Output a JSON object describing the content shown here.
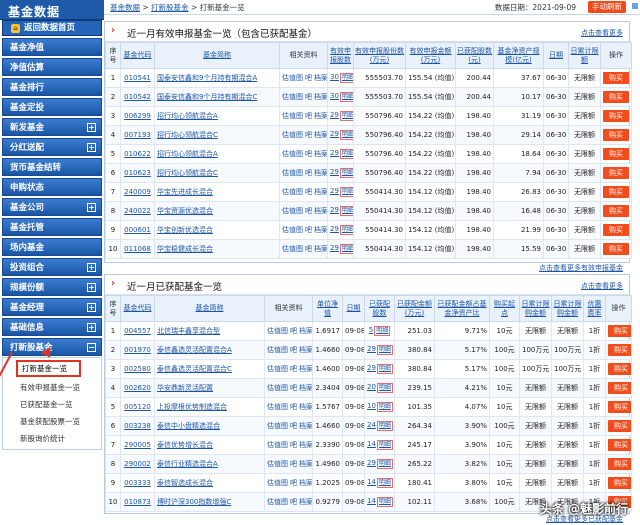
{
  "logo": "基金数据",
  "sidebar": {
    "back_home": "返回数据首页",
    "items": [
      {
        "label": "基金净值",
        "pm": ""
      },
      {
        "label": "净值估算",
        "pm": ""
      },
      {
        "label": "基金排行",
        "pm": ""
      },
      {
        "label": "基金定投",
        "pm": ""
      },
      {
        "label": "新发基金",
        "pm": "+"
      },
      {
        "label": "分红送配",
        "pm": "+"
      },
      {
        "label": "货币基金结转",
        "pm": ""
      },
      {
        "label": "申购状态",
        "pm": ""
      },
      {
        "label": "基金公司",
        "pm": "+"
      },
      {
        "label": "基金托管",
        "pm": ""
      },
      {
        "label": "场内基金",
        "pm": ""
      },
      {
        "label": "投资组合",
        "pm": "+"
      },
      {
        "label": "规模份额",
        "pm": "+"
      },
      {
        "label": "基金经理",
        "pm": "+"
      },
      {
        "label": "基础信息",
        "pm": "+"
      },
      {
        "label": "打新股基金",
        "pm": "−"
      }
    ],
    "sub": [
      {
        "label": "打新基金一览",
        "active": true
      },
      {
        "label": "有效申报基金一览",
        "active": false
      },
      {
        "label": "已获配基金一览",
        "active": false
      },
      {
        "label": "基金获配股票一览",
        "active": false
      },
      {
        "label": "新股询价统计",
        "active": false
      }
    ]
  },
  "topbar": {
    "breadcrumb": [
      "基金数据",
      "打新股基金",
      "打新基金一览"
    ],
    "date_label": "数据日期：2021-09-09",
    "refresh": "手动刷新"
  },
  "panel1": {
    "title": "近一月有效申报基金一览（包含已获配基金）",
    "more": "点击查看更多",
    "footer": "点击查看更多有效申报基金",
    "headers": [
      "序号",
      "基金代码",
      "基金简称",
      "相关资料",
      "有效申报股数",
      "有效申报股份数(万元)",
      "有效申报金额(万元)",
      "已获配股数(元)",
      "基金净资产规模(亿元)",
      "日期",
      "日累计限额",
      "操作"
    ],
    "rows": [
      {
        "no": "1",
        "code": "010541",
        "name": "国泰安信鑫和9个月持有期混合A",
        "rel": [
          "估值图",
          "吧",
          "档案"
        ],
        "days": "30",
        "tag": "明细",
        "shares": "555503.70",
        "amt": "155.54 (均值)",
        "alloc": "200.44",
        "scale": "37.67",
        "date": "06-30",
        "limit": "无限额",
        "op": "购买"
      },
      {
        "no": "2",
        "code": "010542",
        "name": "国泰安信鑫和9个月持有期混合C",
        "rel": [
          "估值图",
          "吧",
          "档案"
        ],
        "days": "30",
        "tag": "明细",
        "shares": "555503.70",
        "amt": "155.54 (均值)",
        "alloc": "200.44",
        "scale": "10.17",
        "date": "06-30",
        "limit": "无限额",
        "op": "购买"
      },
      {
        "no": "3",
        "code": "006299",
        "name": "招行均心领航混合A",
        "rel": [
          "估值图",
          "吧",
          "档案"
        ],
        "days": "29",
        "tag": "明细",
        "shares": "550796.40",
        "amt": "154.22 (均值)",
        "alloc": "198.40",
        "scale": "31.19",
        "date": "06-30",
        "limit": "无限额",
        "op": "购买"
      },
      {
        "no": "4",
        "code": "007193",
        "name": "招行均心领航混合C",
        "rel": [
          "估值图",
          "吧",
          "档案"
        ],
        "days": "29",
        "tag": "明细",
        "shares": "550796.40",
        "amt": "154.22 (均值)",
        "alloc": "198.40",
        "scale": "29.14",
        "date": "06-30",
        "limit": "无限额",
        "op": "购买"
      },
      {
        "no": "5",
        "code": "010622",
        "name": "招行均心领航混合A",
        "rel": [
          "估值图",
          "吧",
          "档案"
        ],
        "days": "29",
        "tag": "明细",
        "shares": "550796.40",
        "amt": "154.22 (均值)",
        "alloc": "198.40",
        "scale": "18.64",
        "date": "06-30",
        "limit": "无限额",
        "op": "购买"
      },
      {
        "no": "6",
        "code": "010623",
        "name": "招行均心领航混合C",
        "rel": [
          "估值图",
          "吧",
          "档案"
        ],
        "days": "29",
        "tag": "明细",
        "shares": "550796.40",
        "amt": "154.22 (均值)",
        "alloc": "198.40",
        "scale": "7.94",
        "date": "06-30",
        "limit": "无限额",
        "op": "购买"
      },
      {
        "no": "7",
        "code": "240009",
        "name": "华宝先进成长混合",
        "rel": [
          "估值图",
          "吧",
          "档案"
        ],
        "days": "29",
        "tag": "明细",
        "shares": "550414.30",
        "amt": "154.12 (均值)",
        "alloc": "198.40",
        "scale": "26.83",
        "date": "06-30",
        "limit": "无限额",
        "op": "购买"
      },
      {
        "no": "8",
        "code": "240022",
        "name": "华宝资源优选混合",
        "rel": [
          "估值图",
          "吧",
          "档案"
        ],
        "days": "29",
        "tag": "明细",
        "shares": "550414.30",
        "amt": "154.12 (均值)",
        "alloc": "198.40",
        "scale": "16.48",
        "date": "06-30",
        "limit": "无限额",
        "op": "购买"
      },
      {
        "no": "9",
        "code": "000601",
        "name": "华宝创新优选混合",
        "rel": [
          "估值图",
          "吧",
          "档案"
        ],
        "days": "29",
        "tag": "明细",
        "shares": "550414.30",
        "amt": "154.12 (均值)",
        "alloc": "198.40",
        "scale": "21.99",
        "date": "06-30",
        "limit": "无限额",
        "op": "购买"
      },
      {
        "no": "10",
        "code": "011068",
        "name": "华宝稳健成长混合",
        "rel": [
          "估值图",
          "吧",
          "档案"
        ],
        "days": "29",
        "tag": "明细",
        "shares": "550414.30",
        "amt": "154.12 (均值)",
        "alloc": "198.40",
        "scale": "15.59",
        "date": "06-30",
        "limit": "无限额",
        "op": "购买"
      }
    ]
  },
  "panel2": {
    "title": "近一月已获配基金一览",
    "more": "点击查看更多",
    "footer": "点击查看更多已获配基金",
    "headers": [
      "序号",
      "基金代码",
      "基金简称",
      "相关资料",
      "单位净值",
      "日期",
      "已获配股数",
      "已获配金额(万元)",
      "已获配金额占基金净资产比",
      "购买起点",
      "日累计限购金额",
      "日累计限购金额",
      "优惠费率",
      "操作"
    ],
    "rows": [
      {
        "no": "1",
        "code": "004557",
        "name": "北信瑞丰鑫享混合型",
        "rel": [
          "估值图",
          "吧",
          "档案"
        ],
        "nav": "1.6917",
        "date": "09-08",
        "cnt": "5",
        "tag": "明细",
        "amt": "251.03",
        "ratio": "9.71%",
        "start": "10元",
        "limit": "无限额",
        "fee": "1折",
        "op": "购买"
      },
      {
        "no": "2",
        "code": "001970",
        "name": "泰信鑫选灵活配置混合A",
        "rel": [
          "估值图",
          "吧",
          "档案"
        ],
        "nav": "1.4660",
        "date": "09-08",
        "cnt": "29",
        "tag": "明细",
        "amt": "380.84",
        "ratio": "5.17%",
        "start": "100元",
        "limit": "100万元",
        "fee": "1折",
        "op": "购买"
      },
      {
        "no": "3",
        "code": "002580",
        "name": "泰信鑫选灵活配置混合C",
        "rel": [
          "估值图",
          "吧",
          "档案"
        ],
        "nav": "1.4600",
        "date": "09-08",
        "cnt": "29",
        "tag": "明细",
        "amt": "380.84",
        "ratio": "5.17%",
        "start": "100元",
        "limit": "100万元",
        "fee": "1折",
        "op": "购买"
      },
      {
        "no": "4",
        "code": "002620",
        "name": "华安鼎新灵活配置",
        "rel": [
          "估值图",
          "吧",
          "档案"
        ],
        "nav": "2.3404",
        "date": "09-08",
        "cnt": "20",
        "tag": "明细",
        "amt": "239.15",
        "ratio": "4.21%",
        "start": "10元",
        "limit": "无限额",
        "fee": "1折",
        "op": "购买"
      },
      {
        "no": "5",
        "code": "005120",
        "name": "上投摩根优势制造混合",
        "rel": [
          "估值图",
          "吧",
          "档案"
        ],
        "nav": "1.5767",
        "date": "09-08",
        "cnt": "10",
        "tag": "明细",
        "amt": "101.35",
        "ratio": "4.07%",
        "start": "10元",
        "limit": "无限额",
        "fee": "1折",
        "op": "购买"
      },
      {
        "no": "6",
        "code": "003238",
        "name": "泰信中小盘精选混合",
        "rel": [
          "估值图",
          "吧",
          "档案"
        ],
        "nav": "1.4660",
        "date": "09-08",
        "cnt": "24",
        "tag": "明细",
        "amt": "264.34",
        "ratio": "3.90%",
        "start": "100元",
        "limit": "无限额",
        "fee": "1折",
        "op": "购买"
      },
      {
        "no": "7",
        "code": "290005",
        "name": "泰信优势增长混合",
        "rel": [
          "估值图",
          "吧",
          "档案"
        ],
        "nav": "2.3390",
        "date": "09-08",
        "cnt": "14",
        "tag": "明细",
        "amt": "245.17",
        "ratio": "3.90%",
        "start": "10元",
        "limit": "无限额",
        "fee": "1折",
        "op": "购买"
      },
      {
        "no": "8",
        "code": "290002",
        "name": "泰信行业精选混合A",
        "rel": [
          "估值图",
          "吧",
          "档案"
        ],
        "nav": "1.4960",
        "date": "09-08",
        "cnt": "29",
        "tag": "明细",
        "amt": "265.22",
        "ratio": "3.82%",
        "start": "10元",
        "limit": "无限额",
        "fee": "1折",
        "op": "购买"
      },
      {
        "no": "9",
        "code": "003333",
        "name": "泰信智选成长混合",
        "rel": [
          "估值图",
          "吧",
          "档案"
        ],
        "nav": "1.2025",
        "date": "09-08",
        "cnt": "14",
        "tag": "明细",
        "amt": "180.41",
        "ratio": "3.80%",
        "start": "10元",
        "limit": "无限额",
        "fee": "1折",
        "op": "购买"
      },
      {
        "no": "10",
        "code": "010873",
        "name": "博时沪深300指数增强C",
        "rel": [
          "估值图",
          "吧",
          "档案"
        ],
        "nav": "0.9279",
        "date": "09-08",
        "cnt": "14",
        "tag": "明细",
        "amt": "102.11",
        "ratio": "3.68%",
        "start": "100元",
        "limit": "无限额",
        "fee": "1折",
        "op": "购买"
      }
    ]
  },
  "watermark": "头条 @魅影前行"
}
